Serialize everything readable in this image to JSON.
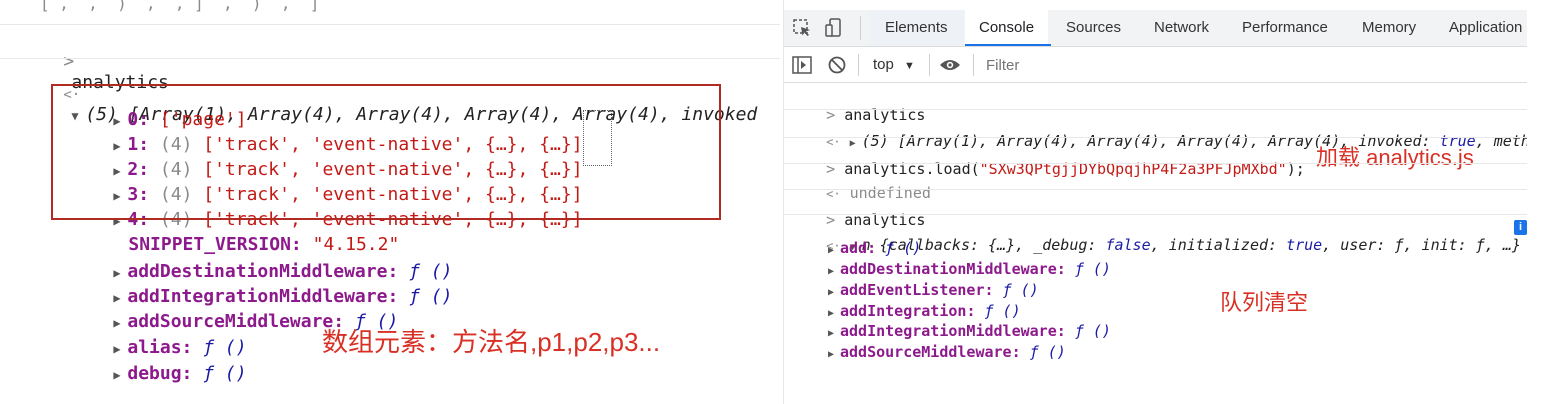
{
  "left": {
    "cut_top": "[ ,  ,  )  ,  , ]  ,  )  ,  ]",
    "prompt_cmd": "analytics",
    "result_summary": "(5) [Array(1), Array(4), Array(4), Array(4), Array(4), invoked",
    "items": [
      {
        "idx": "0",
        "text": "['page']"
      },
      {
        "idx": "1",
        "count": "(4)",
        "text": "['track', 'event-native', {…}, {…}]"
      },
      {
        "idx": "2",
        "count": "(4)",
        "text": "['track', 'event-native', {…}, {…}]"
      },
      {
        "idx": "3",
        "count": "(4)",
        "text": "['track', 'event-native', {…}, {…}]"
      },
      {
        "idx": "4",
        "count": "(4)",
        "text": "['track', 'event-native', {…}, {…}]"
      }
    ],
    "snippet_key": "SNIPPET_VERSION",
    "snippet_val": "\"4.15.2\"",
    "methods": [
      "addDestinationMiddleware",
      "addIntegrationMiddleware",
      "addSourceMiddleware",
      "alias",
      "debug"
    ],
    "fn": "ƒ ()",
    "annotation": "数组元素：方法名,p1,p2,p3..."
  },
  "devtools": {
    "tabs": [
      "Elements",
      "Console",
      "Sources",
      "Network",
      "Performance",
      "Memory",
      "Application"
    ],
    "active_tab": "Console",
    "context": "top",
    "filter_placeholder": "Filter",
    "lines": {
      "cmd1": "analytics",
      "res1": "(5) [Array(1), Array(4), Array(4), Array(4), Array(4), invoked: ",
      "res1_bool": "true",
      "res1_tail": ", metho",
      "cmd2_pre": "analytics.load(",
      "cmd2_str": "\"SXw3QPtgjjDYbQpqjhP4F2a3PFJpMXbd\"",
      "cmd2_post": ");",
      "undef": "undefined",
      "cmd3": "analytics",
      "obj_pre": "n {callbacks: {…}, _debug: ",
      "obj_false": "false",
      "obj_mid": ", initialized: ",
      "obj_true": "true",
      "obj_tail": ", user: ƒ, init: ƒ, …}"
    },
    "props": [
      "add",
      "addDestinationMiddleware",
      "addEventListener",
      "addIntegration",
      "addIntegrationMiddleware",
      "addSourceMiddleware"
    ],
    "fn": "ƒ ()",
    "annot_load": "加载 analytics.js",
    "annot_clear": "队列清空",
    "info_badge": "i"
  }
}
